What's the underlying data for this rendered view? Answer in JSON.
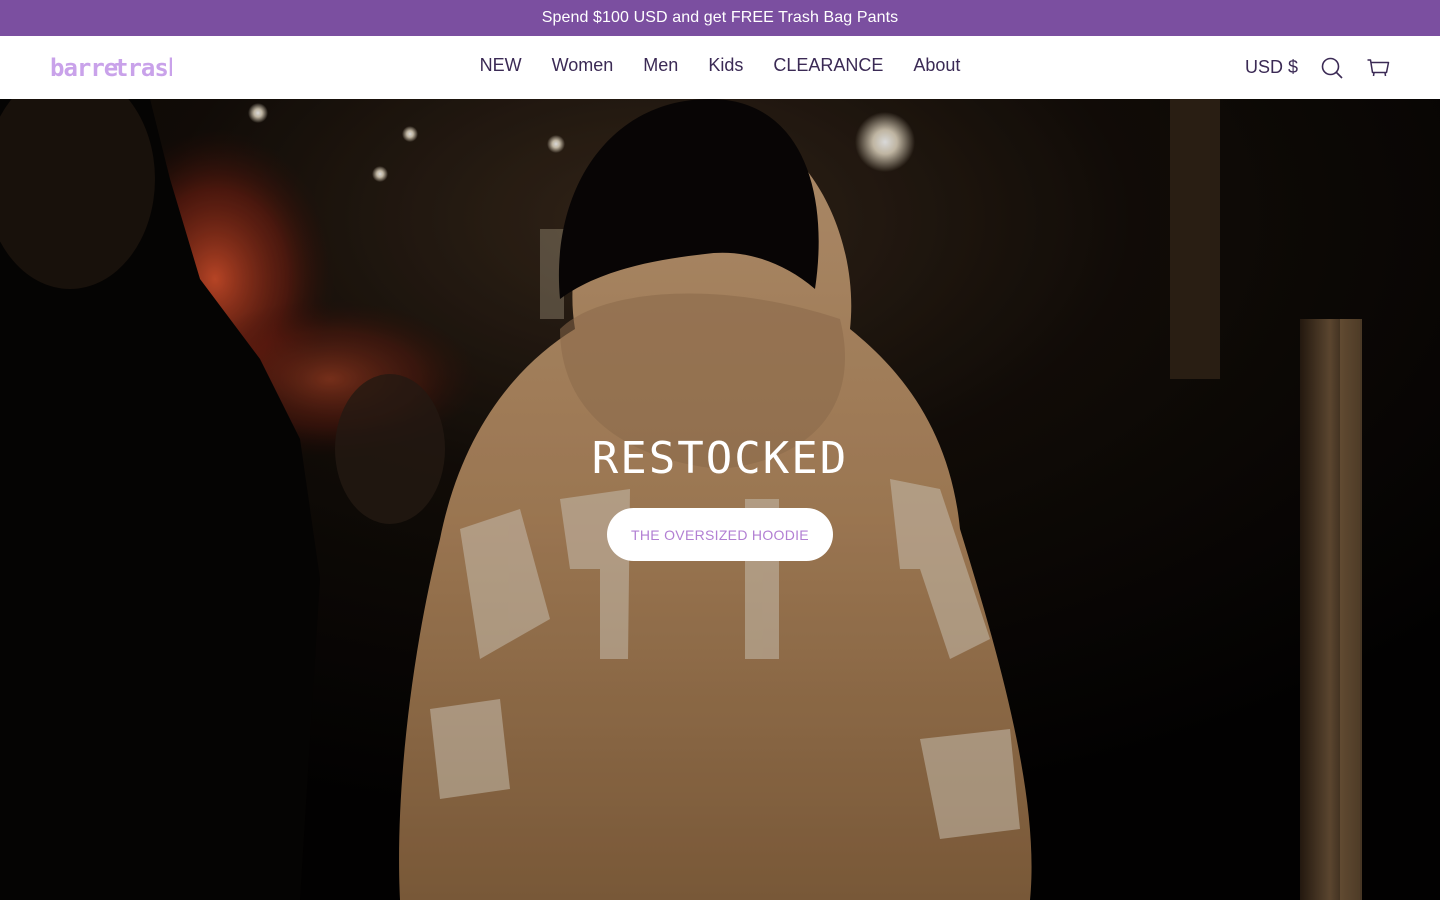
{
  "announcement": {
    "text": "Spend $100 USD and get FREE Trash Bag Pants"
  },
  "header": {
    "logo_text": "BARRE TRASH",
    "nav": [
      {
        "label": "NEW"
      },
      {
        "label": "Women"
      },
      {
        "label": "Men"
      },
      {
        "label": "Kids"
      },
      {
        "label": "CLEARANCE"
      },
      {
        "label": "About"
      }
    ],
    "currency": "USD $",
    "icons": {
      "search": "search-icon",
      "cart": "cart-icon"
    }
  },
  "hero": {
    "title": "RESTOCKED",
    "button_label": "THE OVERSIZED HOODIE",
    "image_description_icon": "hero-image"
  },
  "colors": {
    "announcement_bg": "#7b4fa0",
    "nav_text": "#3b2a55",
    "logo": "#c9a2ea",
    "button_text": "#b27fd3"
  }
}
